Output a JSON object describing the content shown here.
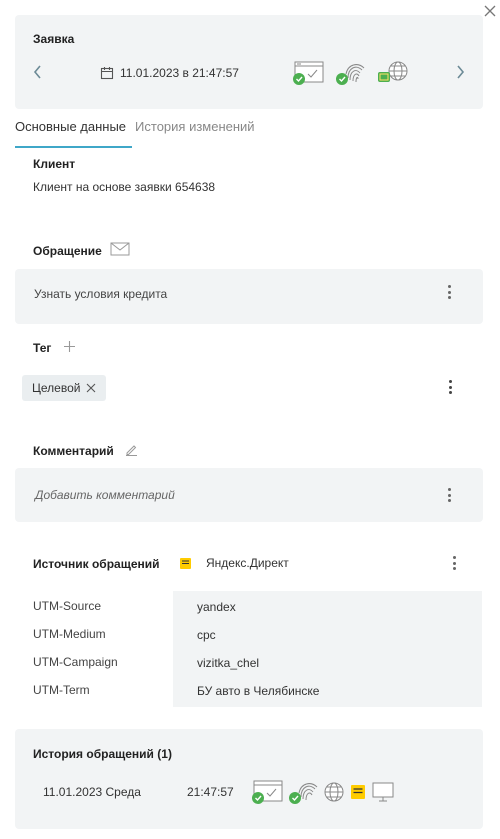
{
  "header": {
    "title": "Заявка",
    "date": "11.01.2023 в 21:47:57"
  },
  "tabs": [
    {
      "label": "Основные данные",
      "active": true
    },
    {
      "label": "История изменений",
      "active": false
    }
  ],
  "client": {
    "label": "Клиент",
    "value": "Клиент на основе заявки 654638"
  },
  "appeal": {
    "label": "Обращение",
    "value": "Узнать условия кредита"
  },
  "tag": {
    "label": "Тег",
    "chip": "Целевой"
  },
  "comment": {
    "label": "Комментарий",
    "placeholder": "Добавить комментарий"
  },
  "source": {
    "label": "Источник обращений",
    "value": "Яндекс.Директ",
    "utm": [
      {
        "key": "UTM-Source",
        "value": "yandex"
      },
      {
        "key": "UTM-Medium",
        "value": "cpc"
      },
      {
        "key": "UTM-Campaign",
        "value": "vizitka_chel"
      },
      {
        "key": "UTM-Term",
        "value": "БУ авто в Челябинске"
      }
    ]
  },
  "history": {
    "title": "История обращений (1)",
    "entries": [
      {
        "date": "11.01.2023 Среда",
        "time": "21:47:57"
      }
    ]
  },
  "colors": {
    "accent": "#3fa7c8",
    "success": "#4caf50",
    "yandex": "#ffcc00",
    "card": "#f2f4f5"
  }
}
